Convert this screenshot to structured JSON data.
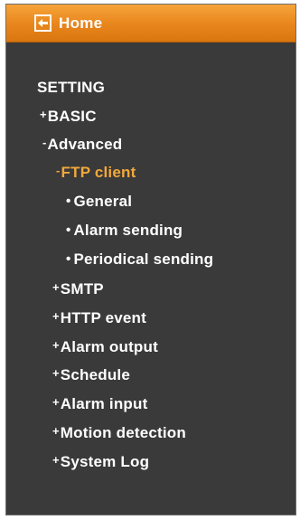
{
  "home": {
    "label": "Home",
    "icon": "back-arrow-icon"
  },
  "menu": {
    "header": "SETTING",
    "items": [
      {
        "marker": "+",
        "label": "BASIC"
      },
      {
        "marker": "-",
        "label": "Advanced"
      },
      {
        "marker": "-",
        "label": "FTP client"
      },
      {
        "marker": "•",
        "label": "General"
      },
      {
        "marker": "•",
        "label": "Alarm sending"
      },
      {
        "marker": "•",
        "label": "Periodical sending"
      },
      {
        "marker": "+",
        "label": "SMTP"
      },
      {
        "marker": "+",
        "label": "HTTP event"
      },
      {
        "marker": "+",
        "label": "Alarm output"
      },
      {
        "marker": "+",
        "label": "Schedule"
      },
      {
        "marker": "+",
        "label": "Alarm input"
      },
      {
        "marker": "+",
        "label": "Motion detection"
      },
      {
        "marker": "+",
        "label": "System Log"
      }
    ]
  },
  "colors": {
    "panel_bg": "#3a3a3a",
    "home_bar": "#e8851c",
    "text": "#ffffff",
    "active": "#f2a83a"
  }
}
